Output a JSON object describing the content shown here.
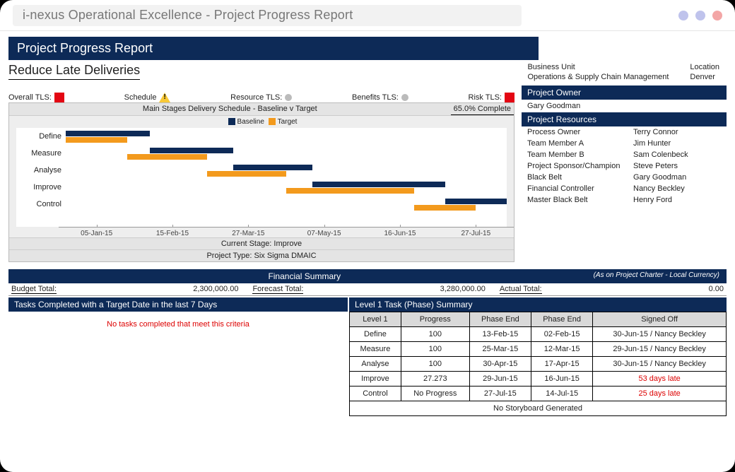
{
  "browser": {
    "title": "i-nexus Operational Excellence - Project Progress Report"
  },
  "dots": {
    "c1": "#bfc3ec",
    "c2": "#bfc3ec",
    "c3": "#f3a6a6"
  },
  "header": {
    "banner": "Project Progress Report",
    "project": "Reduce Late Deliveries"
  },
  "meta": {
    "bu_label": "Business Unit",
    "bu_value": "Operations & Supply Chain Management",
    "loc_label": "Location",
    "loc_value": "Denver"
  },
  "tls": {
    "overall": "Overall TLS:",
    "schedule": "Schedule",
    "resource": "Resource TLS:",
    "benefits": "Benefits TLS:",
    "risk": "Risk TLS:"
  },
  "chart": {
    "title": "Main Stages Delivery Schedule - Baseline v Target",
    "complete": "65.0% Complete",
    "legend_baseline": "Baseline",
    "legend_target": "Target",
    "rows": [
      "Define",
      "Measure",
      "Analyse",
      "Improve",
      "Control"
    ],
    "xticks": [
      "05-Jan-15",
      "15-Feb-15",
      "27-Mar-15",
      "07-May-15",
      "16-Jun-15",
      "27-Jul-15"
    ],
    "stage": "Current Stage: Improve",
    "type": "Project Type: Six Sigma DMAIC"
  },
  "chart_data": {
    "type": "bar",
    "title": "Main Stages Delivery Schedule - Baseline v Target",
    "xlabel": "",
    "ylabel": "",
    "categories": [
      "Define",
      "Measure",
      "Analyse",
      "Improve",
      "Control"
    ],
    "series": [
      {
        "name": "Baseline",
        "values": [
          [
            "05-Jan-15",
            "13-Feb-15"
          ],
          [
            "13-Feb-15",
            "25-Mar-15"
          ],
          [
            "25-Mar-15",
            "30-Apr-15"
          ],
          [
            "30-Apr-15",
            "29-Jun-15"
          ],
          [
            "29-Jun-15",
            "27-Jul-15"
          ]
        ]
      },
      {
        "name": "Target",
        "values": [
          [
            "05-Jan-15",
            "02-Feb-15"
          ],
          [
            "02-Feb-15",
            "12-Mar-15"
          ],
          [
            "12-Mar-15",
            "17-Apr-15"
          ],
          [
            "17-Apr-15",
            "16-Jun-15"
          ],
          [
            "16-Jun-15",
            "14-Jul-15"
          ]
        ]
      }
    ],
    "x_range": [
      "05-Jan-15",
      "27-Jul-15"
    ]
  },
  "side": {
    "owner_h": "Project Owner",
    "owner": "Gary Goodman",
    "res_h": "Project Resources",
    "rows": [
      {
        "role": "Process Owner",
        "name": "Terry Connor"
      },
      {
        "role": "Team Member A",
        "name": "Jim Hunter"
      },
      {
        "role": "Team Member B",
        "name": "Sam Colenbeck"
      },
      {
        "role": "Project Sponsor/Champion",
        "name": "Steve Peters"
      },
      {
        "role": "Black Belt",
        "name": "Gary Goodman"
      },
      {
        "role": "Financial Controller",
        "name": "Nancy Beckley"
      },
      {
        "role": "Master Black Belt",
        "name": "Henry Ford"
      }
    ]
  },
  "financial": {
    "title": "Financial Summary",
    "note": "(As on Project Charter - Local Currency)",
    "budget_l": "Budget Total:",
    "budget_v": "2,300,000.00",
    "forecast_l": "Forecast Total:",
    "forecast_v": "3,280,000.00",
    "actual_l": "Actual Total:",
    "actual_v": "0.00"
  },
  "bottom": {
    "tasks_h": "Tasks Completed with a Target Date in the last 7 Days",
    "no_tasks": "No tasks completed that meet this criteria",
    "phase_h": "Level 1 Task (Phase) Summary",
    "cols": [
      "Level 1",
      "Progress",
      "Phase End",
      "Phase End",
      "Signed Off"
    ],
    "rows": [
      {
        "l": "Define",
        "p": "100",
        "e1": "13-Feb-15",
        "e2": "02-Feb-15",
        "s": "30-Jun-15 / Nancy Beckley",
        "late": false
      },
      {
        "l": "Measure",
        "p": "100",
        "e1": "25-Mar-15",
        "e2": "12-Mar-15",
        "s": "29-Jun-15 / Nancy Beckley",
        "late": false
      },
      {
        "l": "Analyse",
        "p": "100",
        "e1": "30-Apr-15",
        "e2": "17-Apr-15",
        "s": "30-Jun-15 / Nancy Beckley",
        "late": false
      },
      {
        "l": "Improve",
        "p": "27.273",
        "e1": "29-Jun-15",
        "e2": "16-Jun-15",
        "s": "53 days late",
        "late": true
      },
      {
        "l": "Control",
        "p": "No Progress",
        "e1": "27-Jul-15",
        "e2": "14-Jul-15",
        "s": "25 days late",
        "late": true
      }
    ],
    "footer": "No Storyboard Generated"
  }
}
